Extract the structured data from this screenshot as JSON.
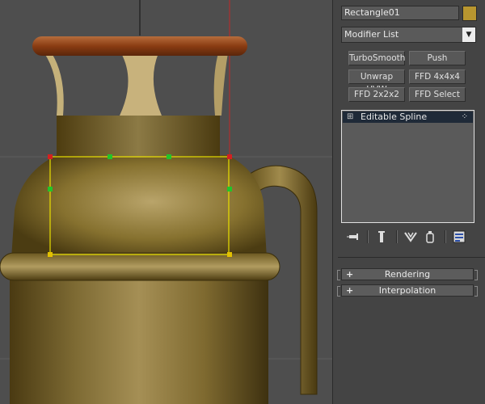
{
  "object_name": "Rectangle01",
  "object_color": "#b8962f",
  "modifier_list": {
    "label": "Modifier List",
    "arrow": "▼"
  },
  "modifier_buttons": [
    "TurboSmooth",
    "Push",
    "Unwrap UVW",
    "FFD 4x4x4",
    "FFD 2x2x2",
    "FFD Select"
  ],
  "stack": {
    "item_label": "Editable Spline",
    "expand_glyph": "⊞",
    "handle_glyph": "⁘"
  },
  "stack_tools": {
    "pin_icon": "pin-stack-icon",
    "show_end_icon": "show-end-result-icon",
    "unique_icon": "make-unique-icon",
    "remove_icon": "remove-modifier-icon",
    "configure_icon": "configure-modifier-sets-icon"
  },
  "rollouts": [
    {
      "label": "Rendering",
      "sign": "+"
    },
    {
      "label": "Interpolation",
      "sign": "+"
    }
  ],
  "colors": {
    "selection": "#e8e000",
    "vertex_corner": "#d42020",
    "vertex_mid": "#22c42a",
    "vertex_bottom": "#e2c000"
  }
}
